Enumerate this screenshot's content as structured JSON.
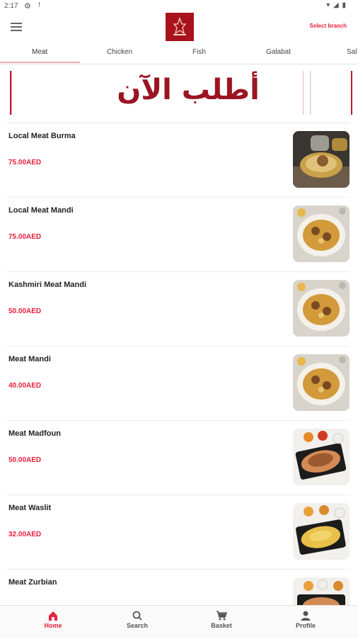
{
  "status_bar": {
    "time": "2:17",
    "icons": [
      "gear-icon",
      "alert-icon",
      "wifi-icon",
      "signal-icon",
      "battery-icon"
    ]
  },
  "app_bar": {
    "menu_icon": "menu-icon",
    "logo": "restaurant-logo",
    "select_branch": "Select branch"
  },
  "tabs": [
    {
      "label": "Meat",
      "active": true
    },
    {
      "label": "Chicken",
      "active": false
    },
    {
      "label": "Fish",
      "active": false
    },
    {
      "label": "Galabat",
      "active": false
    },
    {
      "label": "Sal",
      "active": false
    }
  ],
  "banner": {
    "text": "أطلب الآن"
  },
  "items": [
    {
      "name": "Local Meat Burma",
      "price": "75.00AED"
    },
    {
      "name": "Local Meat Mandi",
      "price": "75.00AED"
    },
    {
      "name": "Kashmiri Meat Mandi",
      "price": "50.00AED"
    },
    {
      "name": "Meat Mandi",
      "price": "40.00AED"
    },
    {
      "name": "Meat Madfoun",
      "price": "50.00AED"
    },
    {
      "name": "Meat Waslit",
      "price": "32.00AED"
    },
    {
      "name": "Meat Zurbian",
      "price": ""
    }
  ],
  "bottom_nav": [
    {
      "label": "Home",
      "icon": "home-icon",
      "active": true
    },
    {
      "label": "Search",
      "icon": "search-icon",
      "active": false
    },
    {
      "label": "Basket",
      "icon": "cart-icon",
      "active": false
    },
    {
      "label": "Profile",
      "icon": "person-icon",
      "active": false
    }
  ],
  "colors": {
    "accent": "#e8203a",
    "brand": "#a8121d",
    "tab_indicator": "#f3a8b2"
  }
}
